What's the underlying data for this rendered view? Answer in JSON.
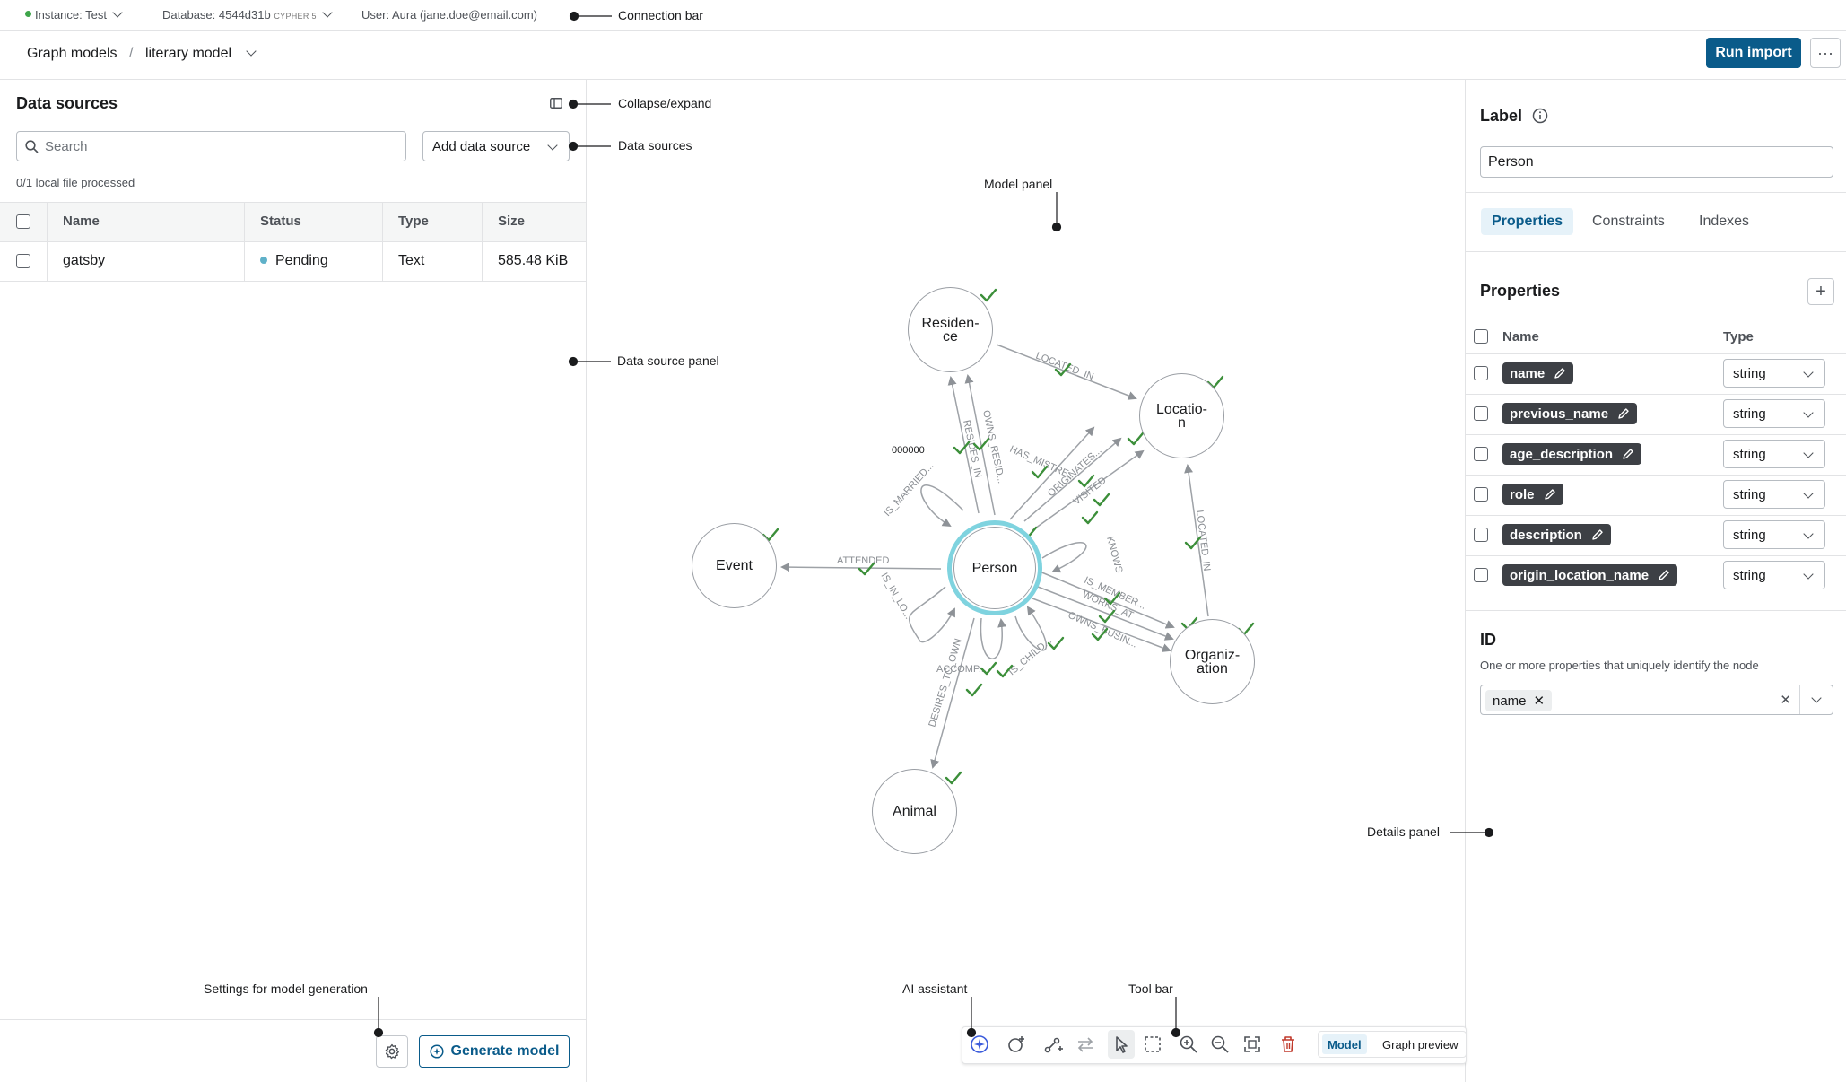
{
  "connection": {
    "instance": "Instance: Test",
    "database": "Database: 4544d31b",
    "database_tag": "CYPHER 5",
    "user": "User: Aura (jane.doe@email.com)"
  },
  "header": {
    "breadcrumb_root": "Graph models",
    "breadcrumb_sep": "/",
    "model_name": "literary model",
    "run_import": "Run import",
    "more": "···"
  },
  "data_sources": {
    "title": "Data sources",
    "search_placeholder": "Search",
    "add_source": "Add data source",
    "status_line": "0/1 local file processed",
    "columns": [
      "Name",
      "Status",
      "Type",
      "Size"
    ],
    "rows": [
      {
        "name": "gatsby",
        "status": "Pending",
        "type": "Text",
        "size": "585.48 KiB"
      }
    ],
    "generate_model": "Generate model",
    "status_color": "#5fb1c9"
  },
  "graph": {
    "nodes": {
      "residence": "Residen-\nce",
      "location": "Locatio-\nn",
      "event": "Event",
      "person": "Person",
      "organization": "Organiz-\nation",
      "animal": "Animal"
    },
    "edge_labels": [
      "LOCATED_IN",
      "RESIDES_IN",
      "OWNS_RESID...",
      "HAS_MISTRE...",
      "ORIGINATES...",
      "VISITED",
      "IS_MARRIED...",
      "ATTENDED",
      "IS_IN_LO...",
      "KNOWS",
      "IS_MEMBER...",
      "WORKS_AT",
      "OWNS_BUSIN...",
      "ACCOMP...",
      "IS_CHILD...",
      "DESIRES_TO_OWN",
      "LOCATED_IN"
    ],
    "loose_label": "000000",
    "check_color": "#3c8f3a",
    "selected_ring": "#7fd3df"
  },
  "details": {
    "label_title": "Label",
    "label_value": "Person",
    "tabs": [
      "Properties",
      "Constraints",
      "Indexes"
    ],
    "properties_title": "Properties",
    "col_name": "Name",
    "col_type": "Type",
    "properties": [
      {
        "name": "name",
        "type": "string"
      },
      {
        "name": "previous_name",
        "type": "string"
      },
      {
        "name": "age_description",
        "type": "string"
      },
      {
        "name": "role",
        "type": "string"
      },
      {
        "name": "description",
        "type": "string"
      },
      {
        "name": "origin_location_name",
        "type": "string"
      }
    ],
    "id_title": "ID",
    "id_desc": "One or more properties that uniquely identify the node",
    "id_tag": "name"
  },
  "toolbar": {
    "model": "Model",
    "graph_preview": "Graph preview"
  },
  "annotations": {
    "connection_bar": "Connection bar",
    "collapse_expand": "Collapse/expand",
    "data_sources": "Data sources",
    "model_panel": "Model panel",
    "data_source_panel": "Data source panel",
    "details_panel": "Details panel",
    "settings_generation": "Settings for model generation",
    "ai_assistant": "AI assistant",
    "tool_bar": "Tool bar"
  }
}
